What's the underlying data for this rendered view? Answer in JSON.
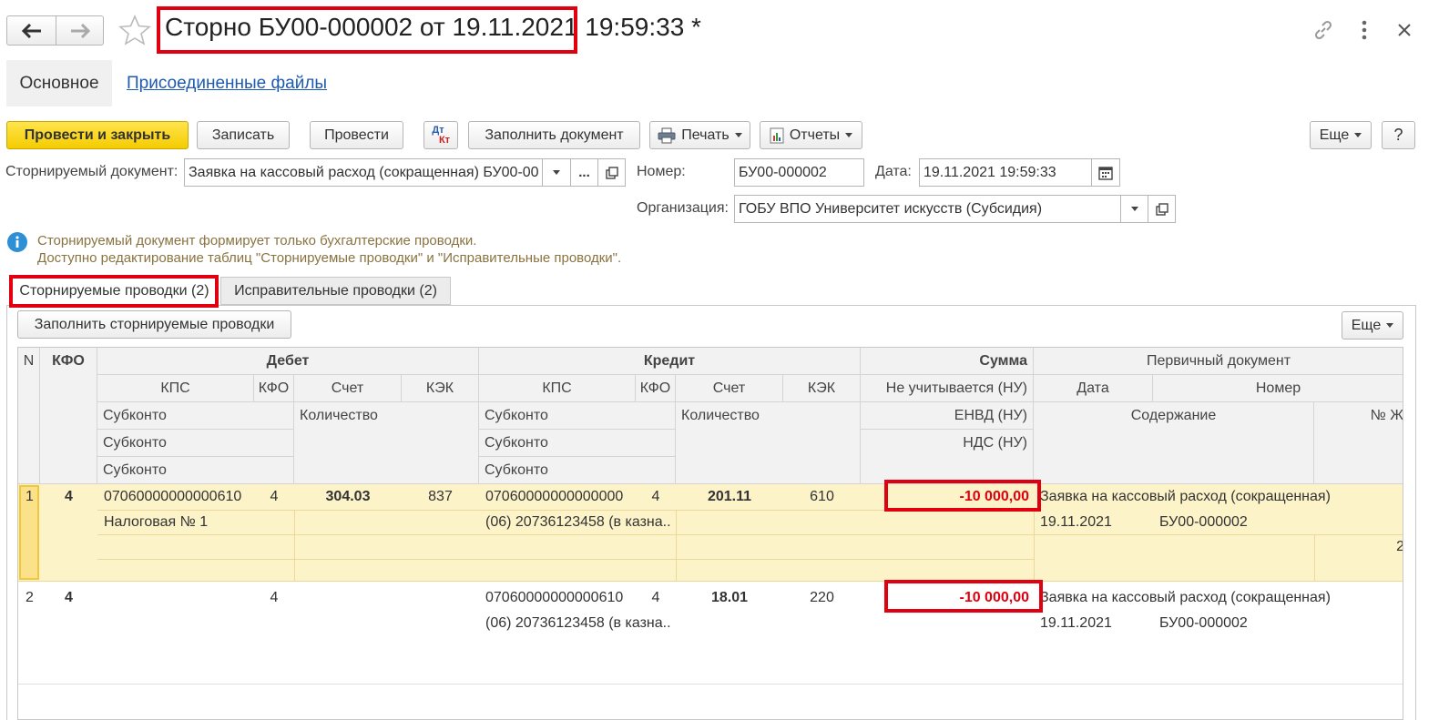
{
  "window": {
    "title": "Сторно БУ00-000002 от 19.11.2021 19:59:33 *",
    "nav_back_icon": "arrow-left-icon",
    "nav_forward_icon": "arrow-right-icon",
    "favorite_icon": "star-icon",
    "link_icon": "link-icon",
    "more_icon": "kebab-icon",
    "close_icon": "close-icon"
  },
  "nav_tabs": [
    {
      "label": "Основное"
    },
    {
      "label": "Присоединенные файлы"
    }
  ],
  "toolbar": {
    "post_close": "Провести и закрыть",
    "save": "Записать",
    "post": "Провести",
    "dtkt_dt": "Дт",
    "dtkt_kt": "Кт",
    "fill_document": "Заполнить документ",
    "print": "Печать",
    "reports": "Отчеты",
    "more": "Еще",
    "help": "?"
  },
  "form": {
    "storno_doc_label": "Сторнируемый документ:",
    "storno_doc_value": "Заявка на кассовый расход (сокращенная) БУ00-00",
    "dots": "...",
    "number_label": "Номер:",
    "number_value": "БУ00-000002",
    "date_label": "Дата:",
    "date_value": "19.11.2021 19:59:33",
    "org_label": "Организация:",
    "org_value": "ГОБУ ВПО Университет искусств (Субсидия)"
  },
  "info": {
    "line1": "Сторнируемый документ формирует только бухгалтерские проводки.",
    "line2": "Доступно редактирование таблиц \"Сторнируемые проводки\" и \"Исправительные проводки\"."
  },
  "tabs": [
    {
      "label": "Сторнируемые проводки (2)"
    },
    {
      "label": "Исправительные проводки (2)"
    }
  ],
  "table_toolbar": {
    "fill_button": "Заполнить сторнируемые проводки",
    "more": "Еще"
  },
  "table_header": {
    "n": "N",
    "kfo": "КФО",
    "debit": "Дебет",
    "credit": "Кредит",
    "sum": "Сумма",
    "primary_doc": "Первичный документ",
    "kps": "КПС",
    "kfo2": "КФО",
    "account": "Счет",
    "kek": "КЭК",
    "not_counted": "Не учитывается (НУ)",
    "date": "Дата",
    "number": "Номер",
    "subkonto": "Субконто",
    "quantity": "Количество",
    "envd": "ЕНВД (НУ)",
    "content": "Содержание",
    "journal_no": "№ Ж",
    "nds": "НДС (НУ)"
  },
  "rows": [
    {
      "n": "1",
      "kfo": "4",
      "dt_kps": "07060000000000610",
      "dt_kfo": "4",
      "dt_account": "304.03",
      "dt_kek": "837",
      "dt_subkonto1": "Налоговая № 1",
      "kt_kps": "07060000000000000",
      "kt_kfo": "4",
      "kt_account": "201.11",
      "kt_kek": "610",
      "kt_subkonto1": "(06) 20736123458 (в казна...",
      "sum": "-10 000,00",
      "doc_content": "Заявка на кассовый расход (сокращенная)",
      "doc_date": "19.11.2021",
      "doc_number": "БУ00-000002",
      "journal_no": "2"
    },
    {
      "n": "2",
      "kfo": "4",
      "dt_kfo": "4",
      "kt_kps": "07060000000000610",
      "kt_kfo": "4",
      "kt_account": "18.01",
      "kt_kek": "220",
      "kt_subkonto1": "(06) 20736123458 (в казна...",
      "sum": "-10 000,00",
      "doc_content": "Заявка на кассовый расход (сокращенная)",
      "doc_date": "19.11.2021",
      "doc_number": "БУ00-000002"
    }
  ]
}
